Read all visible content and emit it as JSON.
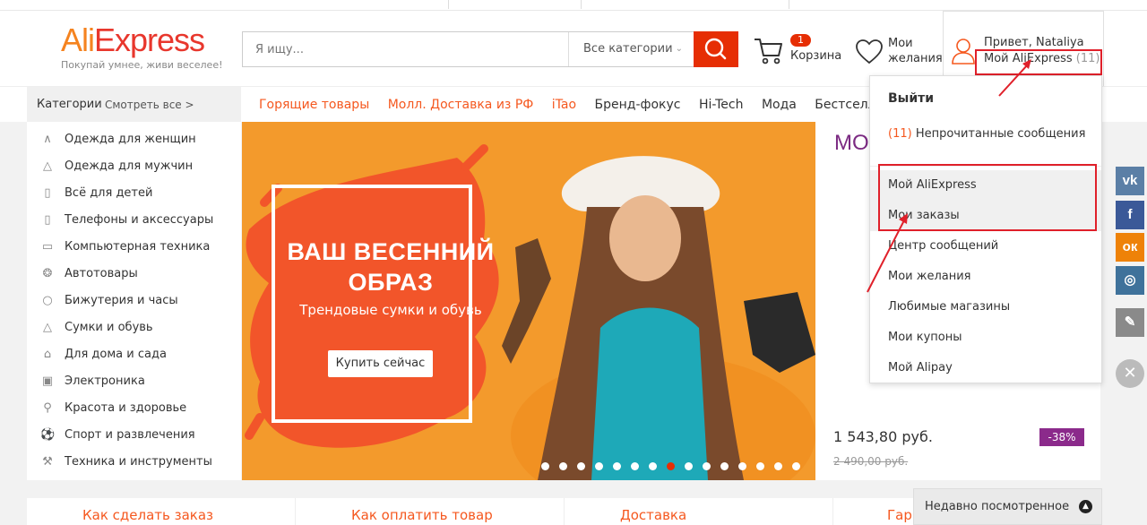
{
  "header": {
    "logo_main_a": "Ali",
    "logo_main_b": "Express",
    "logo_tagline": "Покупай умнее, живи веселее!",
    "search_placeholder": "Я ищу...",
    "search_category": "Все категории",
    "cart_count": "1",
    "cart_label": "Корзина",
    "wish_line1": "Мои",
    "wish_line2": "желания",
    "greeting": "Привет, Nataliya",
    "my_account": "Мой AliExpress",
    "my_account_count": "(11)"
  },
  "nav": {
    "categories_title": "Категории",
    "see_all": "Смотреть все >",
    "links": [
      {
        "label": "Горящие товары",
        "hot": true
      },
      {
        "label": "Молл. Доставка из РФ",
        "hot": true
      },
      {
        "label": "iTao",
        "hot": true
      },
      {
        "label": "Бренд-фокус",
        "hot": false
      },
      {
        "label": "Hi-Tech",
        "hot": false
      },
      {
        "label": "Мода",
        "hot": false
      },
      {
        "label": "Бестселлеры",
        "hot": false
      }
    ]
  },
  "categories": [
    {
      "label": "Одежда для женщин",
      "icon": "dress-icon"
    },
    {
      "label": "Одежда для мужчин",
      "icon": "shirt-icon"
    },
    {
      "label": "Всё для детей",
      "icon": "baby-bottle-icon"
    },
    {
      "label": "Телефоны и аксессуары",
      "icon": "phone-icon"
    },
    {
      "label": "Компьютерная техника",
      "icon": "laptop-icon"
    },
    {
      "label": "Автотовары",
      "icon": "wheel-icon"
    },
    {
      "label": "Бижутерия и часы",
      "icon": "ring-icon"
    },
    {
      "label": "Сумки и обувь",
      "icon": "bag-icon"
    },
    {
      "label": "Для дома и сада",
      "icon": "house-icon"
    },
    {
      "label": "Электроника",
      "icon": "camera-icon"
    },
    {
      "label": "Красота и здоровье",
      "icon": "lipstick-icon"
    },
    {
      "label": "Спорт и развлечения",
      "icon": "ball-icon"
    },
    {
      "label": "Техника и инструменты",
      "icon": "tools-icon"
    }
  ],
  "banner": {
    "title": "ВАШ ВЕСЕННИЙ ОБРАЗ",
    "subtitle": "Трендовые сумки и обувь",
    "button": "Купить сейчас",
    "dots_total": 15,
    "active_dot": 7
  },
  "promo": {
    "heading": "МО",
    "price": "1 543,80 руб.",
    "old_price": "2 490,00 руб.",
    "discount": "-38%"
  },
  "dropdown": {
    "logout": "Выйти",
    "unread_count": "(11)",
    "unread_label": "Непрочитанные сообщения",
    "items": [
      {
        "label": "Мой AliExpress",
        "highlight": true
      },
      {
        "label": "Мои заказы",
        "highlight": true
      },
      {
        "label": "Центр сообщений",
        "highlight": false
      },
      {
        "label": "Мои желания",
        "highlight": false
      },
      {
        "label": "Любимые магазины",
        "highlight": false
      },
      {
        "label": "Мои купоны",
        "highlight": false
      },
      {
        "label": "Мой Alipay",
        "highlight": false
      }
    ]
  },
  "social": [
    {
      "icon": "vk-icon",
      "glyph": "vk",
      "color": "#5b7fa6"
    },
    {
      "icon": "facebook-icon",
      "glyph": "f",
      "color": "#3b5998"
    },
    {
      "icon": "odnoklassniki-icon",
      "glyph": "ок",
      "color": "#ee8208"
    },
    {
      "icon": "instagram-icon",
      "glyph": "◎",
      "color": "#3f729b"
    },
    {
      "icon": "edit-icon",
      "glyph": "✎",
      "color": "#8a8a8a"
    }
  ],
  "bottom": {
    "items": [
      "Как сделать заказ",
      "Как оплатить товар",
      "Доставка",
      "Гар"
    ],
    "recent": "Недавно посмотренное"
  },
  "colors": {
    "accent": "#e62e04",
    "orange": "#f5581f",
    "highlight_box": "#e0202a"
  }
}
